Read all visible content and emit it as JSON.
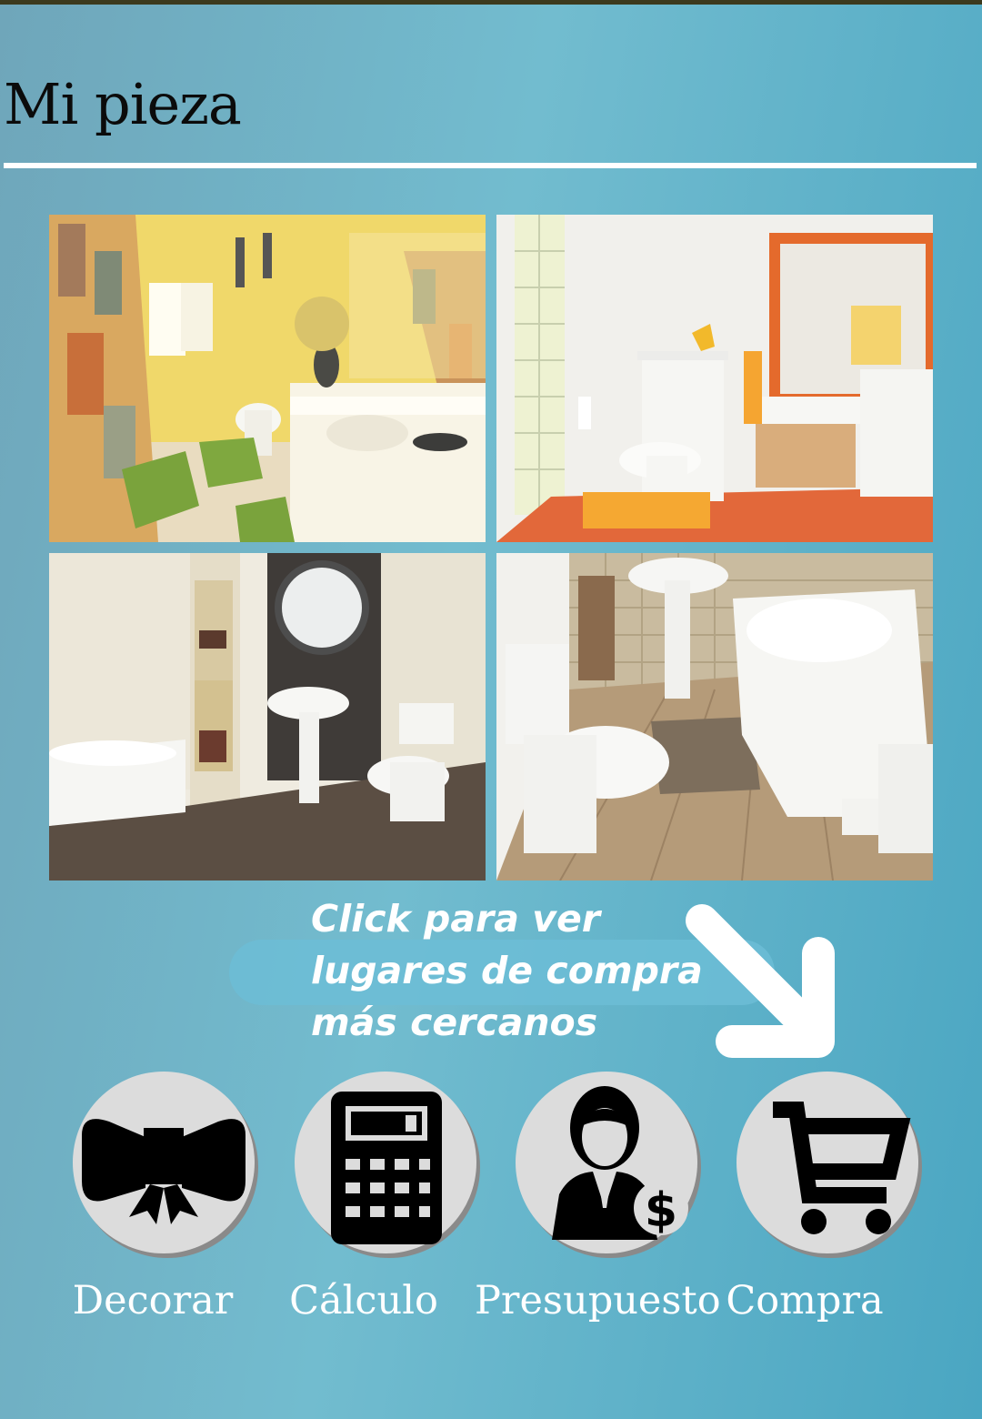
{
  "header": {
    "title": "Mi pieza"
  },
  "gallery": [
    {
      "name": "bathroom-yellow"
    },
    {
      "name": "bathroom-orange"
    },
    {
      "name": "bathroom-gray"
    },
    {
      "name": "bathroom-wood"
    }
  ],
  "hint": {
    "line1": "Click para ver",
    "line2": "lugares de compra",
    "line3": "más cercanos"
  },
  "nav": {
    "decorar": {
      "label": "Decorar",
      "icon": "bow-icon"
    },
    "calculo": {
      "label": "Cálculo",
      "icon": "calculator-icon"
    },
    "presupuesto": {
      "label": "Presupuesto",
      "icon": "budget-person-icon"
    },
    "compra": {
      "label": "Compra",
      "icon": "shopping-cart-icon"
    }
  },
  "colors": {
    "background": "#5fb2ca",
    "rule": "#ffffff",
    "circle": "#dcdcdc",
    "icon": "#000000"
  }
}
